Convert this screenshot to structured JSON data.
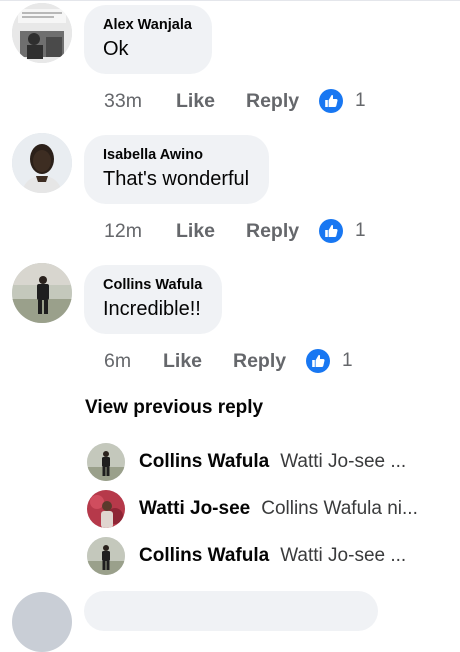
{
  "comments": [
    {
      "author": "Alex Wanjala",
      "text": "Ok",
      "time": "33m",
      "like_label": "Like",
      "reply_label": "Reply",
      "reaction_count": "1",
      "avatar_icon": "user-photo-icon"
    },
    {
      "author": "Isabella Awino",
      "text": "That's wonderful",
      "time": "12m",
      "like_label": "Like",
      "reply_label": "Reply",
      "reaction_count": "1",
      "avatar_icon": "user-photo-icon"
    },
    {
      "author": "Collins Wafula",
      "text": "Incredible!!",
      "time": "6m",
      "like_label": "Like",
      "reply_label": "Reply",
      "reaction_count": "1",
      "avatar_icon": "user-photo-icon"
    }
  ],
  "view_previous_reply": "View previous reply",
  "reply_previews": [
    {
      "author": "Collins Wafula",
      "text": "Watti Jo-see ..."
    },
    {
      "author": "Watti Jo-see",
      "text": "Collins Wafula ni..."
    },
    {
      "author": "Collins Wafula",
      "text": "Watti Jo-see ..."
    }
  ],
  "colors": {
    "accent": "#1877f2",
    "bubble": "#f0f2f5",
    "secondary_text": "#65676b"
  },
  "icons": {
    "reaction": "like-reaction-icon"
  }
}
